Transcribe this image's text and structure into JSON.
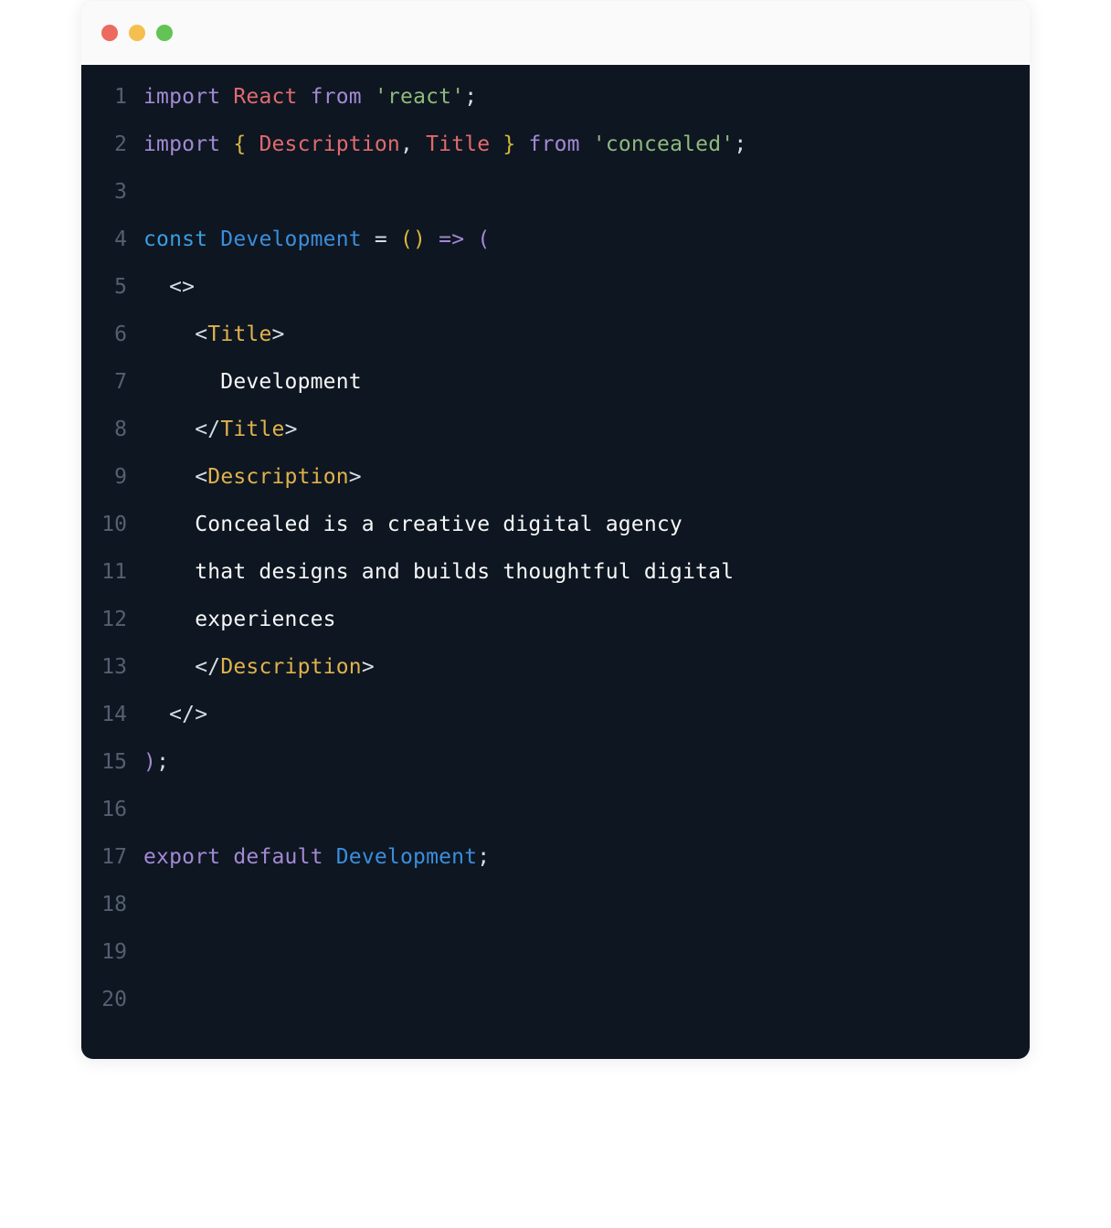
{
  "window": {
    "traffic_lights": [
      "close",
      "minimize",
      "zoom"
    ]
  },
  "code": {
    "lines": [
      {
        "n": "1",
        "tokens": [
          [
            "kw-purple",
            "import "
          ],
          [
            "id-red",
            "React"
          ],
          [
            "punct",
            " "
          ],
          [
            "kw-purple",
            "from"
          ],
          [
            "punct",
            " "
          ],
          [
            "str",
            "'react'"
          ],
          [
            "punct",
            ";"
          ]
        ]
      },
      {
        "n": "2",
        "tokens": [
          [
            "kw-purple",
            "import "
          ],
          [
            "brace",
            "{ "
          ],
          [
            "id-red",
            "Description"
          ],
          [
            "punct",
            ", "
          ],
          [
            "id-red",
            "Title"
          ],
          [
            "brace",
            " }"
          ],
          [
            "punct",
            " "
          ],
          [
            "kw-purple",
            "from"
          ],
          [
            "punct",
            " "
          ],
          [
            "str",
            "'concealed'"
          ],
          [
            "punct",
            ";"
          ]
        ]
      },
      {
        "n": "3",
        "tokens": []
      },
      {
        "n": "4",
        "tokens": [
          [
            "kw-blue",
            "const "
          ],
          [
            "fn-blue",
            "Development"
          ],
          [
            "eq",
            " = "
          ],
          [
            "paren1",
            "("
          ],
          [
            "paren1",
            ")"
          ],
          [
            "punct",
            " "
          ],
          [
            "arrow",
            "=>"
          ],
          [
            "punct",
            " "
          ],
          [
            "paren2",
            "("
          ]
        ]
      },
      {
        "n": "5",
        "tokens": [
          [
            "punct",
            "  "
          ],
          [
            "angle",
            "<>"
          ]
        ]
      },
      {
        "n": "6",
        "tokens": [
          [
            "punct",
            "    "
          ],
          [
            "angle",
            "<"
          ],
          [
            "tagname",
            "Title"
          ],
          [
            "angle",
            ">"
          ]
        ]
      },
      {
        "n": "7",
        "tokens": [
          [
            "text",
            "      Development"
          ]
        ]
      },
      {
        "n": "8",
        "tokens": [
          [
            "punct",
            "    "
          ],
          [
            "angle",
            "</"
          ],
          [
            "tagname",
            "Title"
          ],
          [
            "angle",
            ">"
          ]
        ]
      },
      {
        "n": "9",
        "tokens": [
          [
            "punct",
            "    "
          ],
          [
            "angle",
            "<"
          ],
          [
            "tagname",
            "Description"
          ],
          [
            "angle",
            ">"
          ]
        ]
      },
      {
        "n": "10",
        "tokens": [
          [
            "text",
            "    Concealed is a creative digital agency"
          ]
        ]
      },
      {
        "n": "11",
        "tokens": [
          [
            "text",
            "    that designs and builds thoughtful digital"
          ]
        ]
      },
      {
        "n": "12",
        "tokens": [
          [
            "text",
            "    experiences"
          ]
        ]
      },
      {
        "n": "13",
        "tokens": [
          [
            "punct",
            "    "
          ],
          [
            "angle",
            "</"
          ],
          [
            "tagname",
            "Description"
          ],
          [
            "angle",
            ">"
          ]
        ]
      },
      {
        "n": "14",
        "tokens": [
          [
            "punct",
            "  "
          ],
          [
            "angle",
            "</"
          ],
          [
            "angle",
            ">"
          ]
        ]
      },
      {
        "n": "15",
        "tokens": [
          [
            "paren2",
            ")"
          ],
          [
            "punct",
            ";"
          ]
        ]
      },
      {
        "n": "16",
        "tokens": []
      },
      {
        "n": "17",
        "tokens": [
          [
            "kw-purple",
            "export "
          ],
          [
            "kw-purple",
            "default "
          ],
          [
            "fn-blue",
            "Development"
          ],
          [
            "punct",
            ";"
          ]
        ]
      },
      {
        "n": "18",
        "tokens": []
      },
      {
        "n": "19",
        "tokens": []
      },
      {
        "n": "20",
        "tokens": []
      }
    ]
  }
}
